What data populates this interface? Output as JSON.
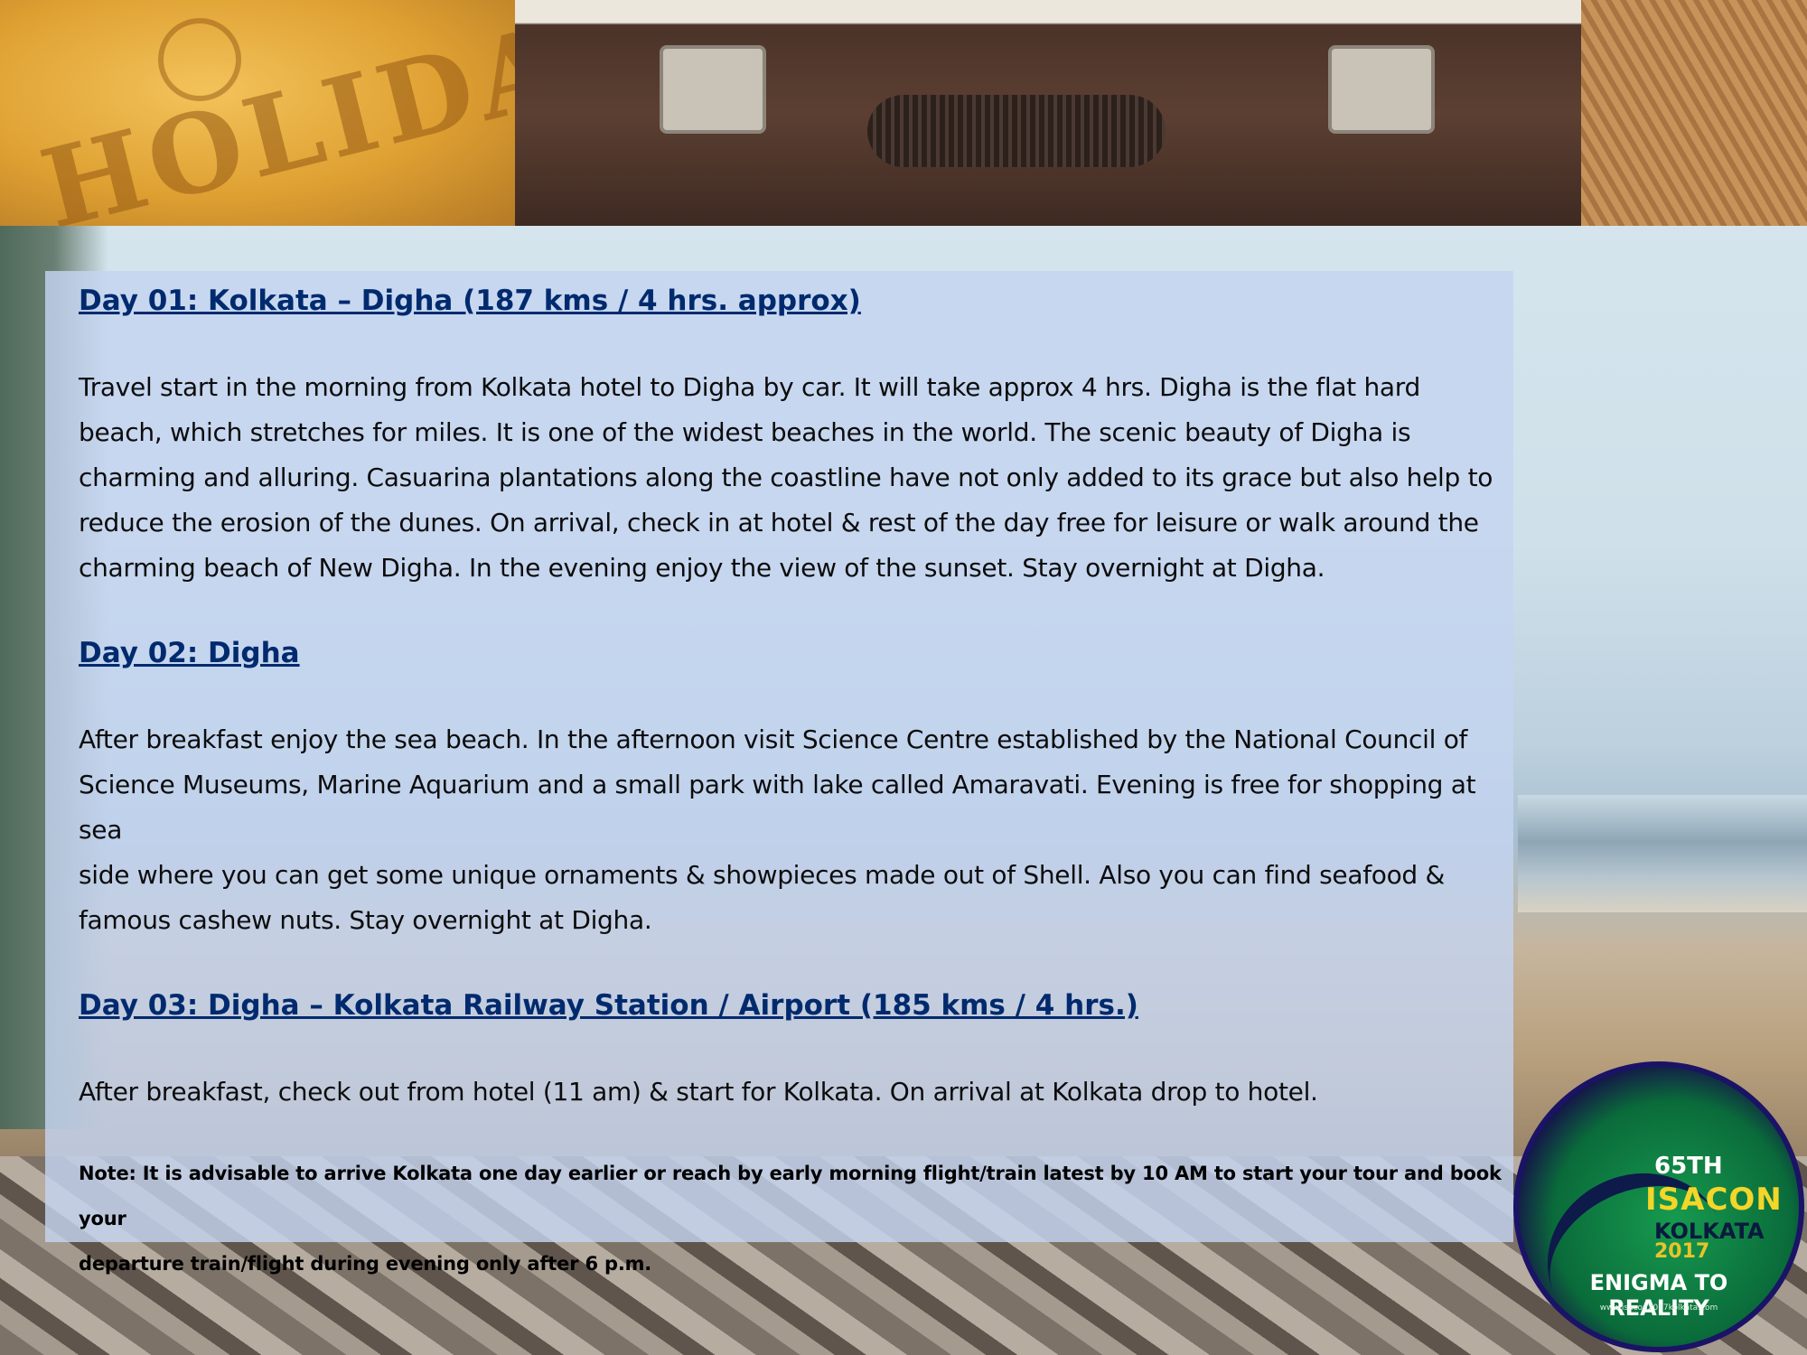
{
  "day1": {
    "heading": "Day 01: Kolkata – Digha (187 kms / 4 hrs. approx)",
    "lines": [
      "Travel start in the morning from Kolkata hotel to Digha by car. It will take approx 4 hrs. Digha is the flat hard",
      "beach, which stretches for miles. It is one of the widest beaches in the world. The scenic beauty of Digha is",
      "charming and alluring. Casuarina plantations along the coastline have not only added to its grace but also help to",
      "reduce the erosion of the dunes.  On arrival, check in at hotel & rest of the day free for leisure or walk around the",
      "charming beach of New Digha. In the evening enjoy the view of the sunset. Stay overnight at Digha."
    ]
  },
  "day2": {
    "heading": "Day 02: Digha",
    "lines": [
      "After breakfast enjoy the sea beach. In the afternoon visit Science Centre established by the National Council of",
      "Science Museums, Marine Aquarium and a small park with lake called Amaravati. Evening is free for shopping at sea",
      "side where you can get some unique ornaments & showpieces made out of Shell. Also you can find seafood &",
      "famous cashew nuts. Stay overnight at Digha."
    ]
  },
  "day3": {
    "heading": "Day 03: Digha – Kolkata Railway Station / Airport (185 kms / 4 hrs.)",
    "lines": [
      "After breakfast, check out from hotel (11 am) & start for Kolkata. On arrival at Kolkata drop to hotel."
    ]
  },
  "note": {
    "lines": [
      "Note:  It is advisable to arrive Kolkata one day earlier or reach by early morning flight/train latest by 10 AM to start your tour and book your",
      "departure train/flight during evening only after 6 p.m."
    ]
  },
  "decor": {
    "holiday_sand_text": "HOLIDAY"
  },
  "logo": {
    "ordinal": "65TH",
    "name": "ISACON",
    "city": "KOLKATA",
    "year": "2017",
    "tagline": "ENIGMA TO REALITY",
    "url": "www.isacon2017kolkata.com"
  }
}
